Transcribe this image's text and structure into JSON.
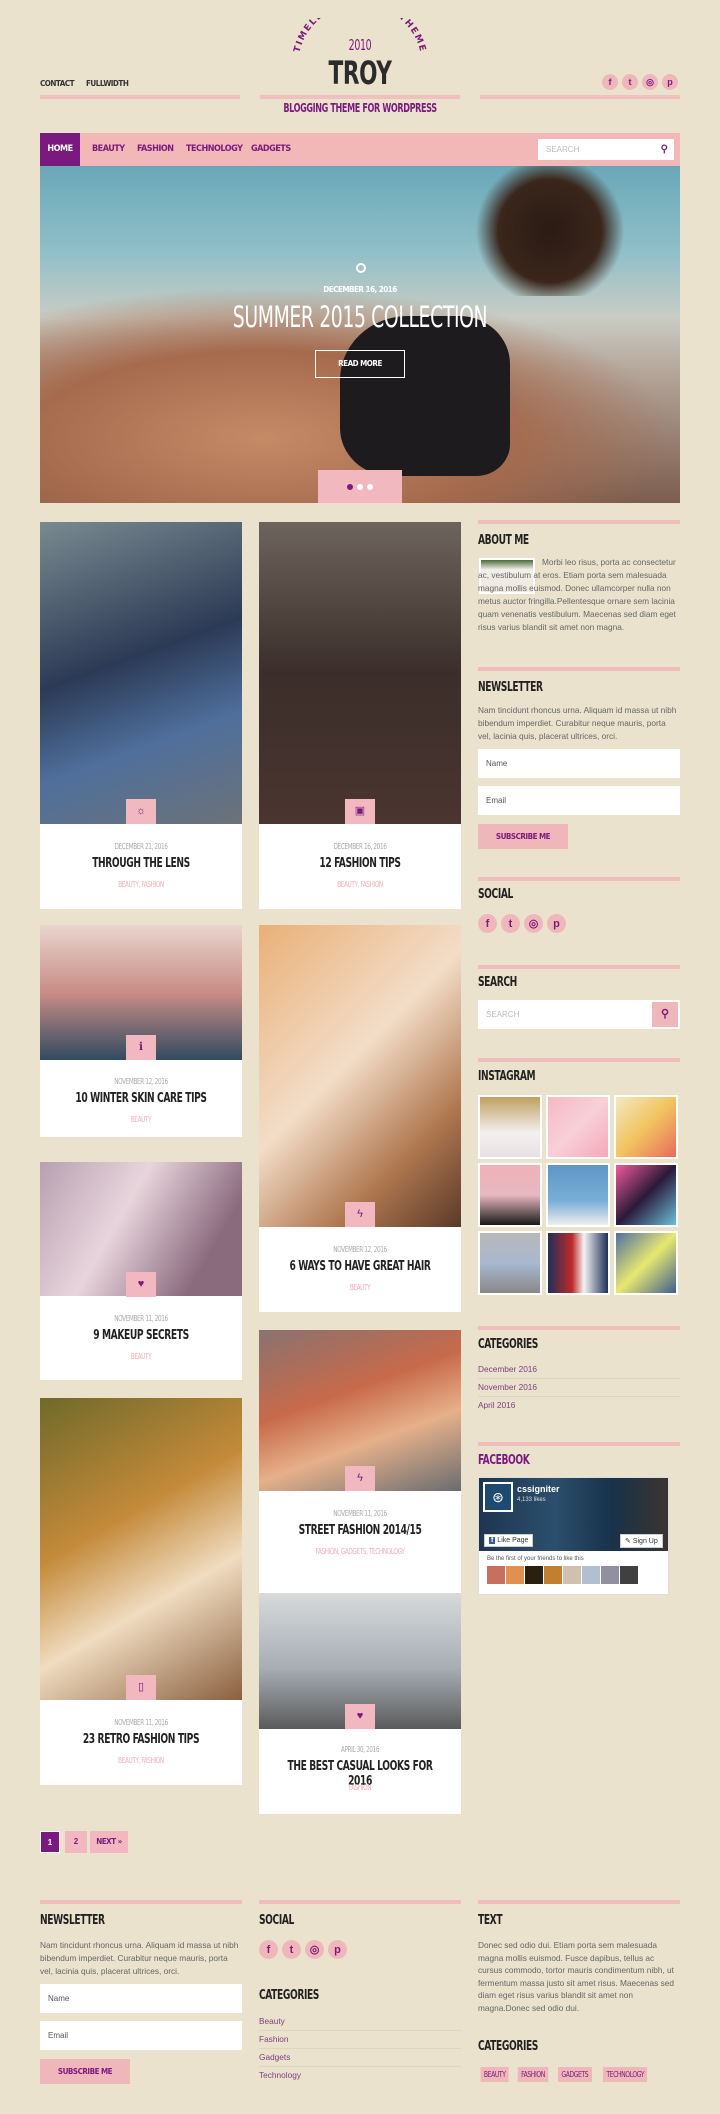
{
  "header": {
    "top_links": [
      "CONTACT",
      "FULLWIDTH"
    ],
    "arc_text": "TIMELESS FASHION THEME",
    "year": "2010",
    "logo": "TROY",
    "tagline": "BLOGGING THEME FOR WORDPRESS",
    "social_icons": [
      "facebook-icon",
      "twitter-icon",
      "instagram-icon",
      "pinterest-icon"
    ]
  },
  "nav": {
    "items": [
      "HOME",
      "BEAUTY",
      "FASHION",
      "TECHNOLOGY",
      "GADGETS"
    ],
    "active": "HOME",
    "search_placeholder": "SEARCH"
  },
  "hero": {
    "date": "DECEMBER 16, 2016",
    "title": "SUMMER 2015 COLLECTION",
    "button": "READ MORE",
    "slides": 3,
    "active_slide": 1
  },
  "posts": [
    {
      "date": "DECEMBER 21, 2016",
      "title": "THROUGH THE LENS",
      "cats": "BEAUTY, FASHION",
      "icon": "aperture-icon"
    },
    {
      "date": "DECEMBER 16, 2016",
      "title": "12 FASHION TIPS",
      "cats": "BEAUTY, FASHION",
      "icon": "image-icon"
    },
    {
      "date": "NOVEMBER 12, 2016",
      "title": "10 WINTER SKIN CARE TIPS",
      "cats": "BEAUTY",
      "icon": "info-icon"
    },
    {
      "date": "NOVEMBER 12, 2016",
      "title": "6 WAYS TO HAVE GREAT HAIR",
      "cats": "BEAUTY",
      "icon": "bolt-icon"
    },
    {
      "date": "NOVEMBER 11, 2016",
      "title": "9 MAKEUP SECRETS",
      "cats": "BEAUTY",
      "icon": "heart-icon"
    },
    {
      "date": "NOVEMBER 11, 2016",
      "title": "STREET FASHION 2014/15",
      "cats": "FASHION, GADGETS, TECHNOLOGY",
      "icon": "bolt-icon"
    },
    {
      "date": "NOVEMBER 11, 2016",
      "title": "23 RETRO FASHION TIPS",
      "cats": "BEAUTY, FASHION",
      "icon": "phone-icon"
    },
    {
      "date": "APRIL 30, 2016",
      "title": "THE BEST CASUAL LOOKS FOR 2016",
      "cats": "FASHION",
      "icon": "heart-icon"
    }
  ],
  "pagination": {
    "pages": [
      "1",
      "2"
    ],
    "current": "1",
    "next": "NEXT »"
  },
  "sidebar": {
    "about": {
      "title": "ABOUT ME",
      "text": "Morbi leo risus, porta ac consectetur ac, vestibulum at eros. Etiam porta sem malesuada magna mollis euismod. Donec ullamcorper nulla non metus auctor fringilla.Pellentesque ornare sem lacinia quam venenatis vestibulum. Maecenas sed diam eget risus varius blandit sit amet non magna."
    },
    "newsletter": {
      "title": "NEWSLETTER",
      "text": "Nam tincidunt rhoncus urna. Aliquam id massa ut nibh bibendum imperdiet. Curabitur neque mauris, porta vel, lacinia quis, placerat ultrices, orci.",
      "name_placeholder": "Name",
      "email_placeholder": "Email",
      "button": "SUBSCRIBE ME"
    },
    "social": {
      "title": "SOCIAL"
    },
    "search": {
      "title": "SEARCH",
      "placeholder": "SEARCH"
    },
    "instagram": {
      "title": "INSTAGRAM",
      "count": 9
    },
    "categories": {
      "title": "CATEGORIES",
      "items": [
        "December 2016",
        "November 2016",
        "April 2016"
      ]
    },
    "facebook": {
      "title": "FACEBOOK",
      "page_name": "cssigniter",
      "likes": "4,133 likes",
      "like_button": "Like Page",
      "signup_button": "Sign Up",
      "friends_text": "Be the first of your friends to like this"
    }
  },
  "footer": {
    "newsletter": {
      "title": "NEWSLETTER",
      "text": "Nam tincidunt rhoncus urna. Aliquam id massa ut nibh bibendum imperdiet. Curabitur neque mauris, porta vel, lacinia quis, placerat ultrices, orci.",
      "name_placeholder": "Name",
      "email_placeholder": "Email",
      "button": "SUBSCRIBE ME"
    },
    "social": {
      "title": "SOCIAL"
    },
    "categories": {
      "title": "CATEGORIES",
      "items": [
        "Beauty",
        "Fashion",
        "Gadgets",
        "Technology"
      ]
    },
    "text": {
      "title": "TEXT",
      "body": "Donec sed odio dui. Etiam porta sem malesuada magna mollis euismod. Fusce dapibus, tellus ac cursus commodo, tortor mauris condimentum nibh, ut fermentum massa justo sit amet risus. Maecenas sed diam eget risus varius blandit sit amet non magna.Donec sed odio dui."
    },
    "tags": {
      "title": "CATEGORIES",
      "items": [
        "BEAUTY",
        "FASHION",
        "GADGETS",
        "TECHNOLOGY"
      ]
    }
  },
  "colors": {
    "background": "#ebe2cd",
    "accent": "#7b1a7e",
    "pink": "#f2b8b8"
  }
}
